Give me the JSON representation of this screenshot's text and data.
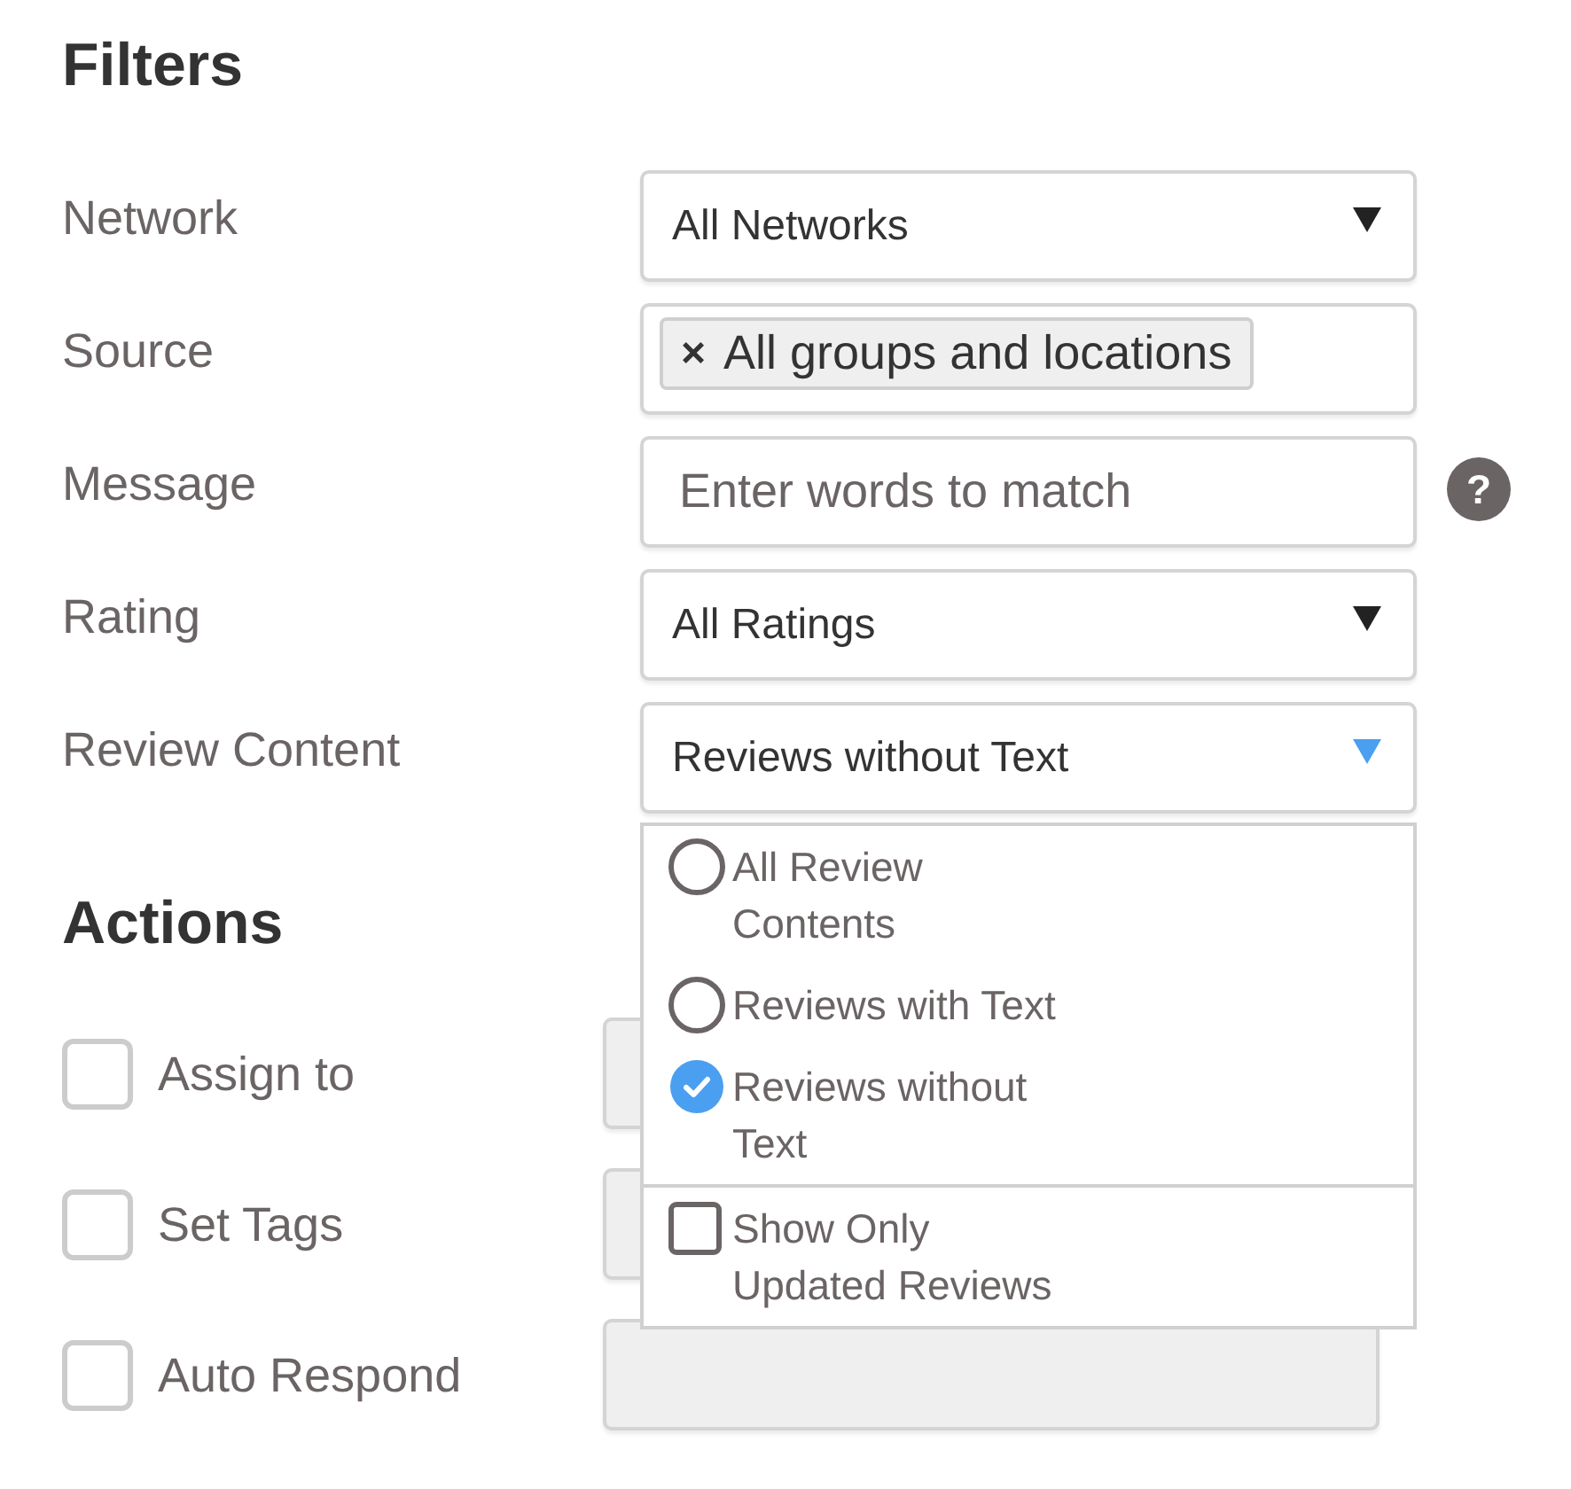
{
  "filters": {
    "title": "Filters",
    "rows": [
      {
        "label": "Network",
        "kind": "select",
        "value": "All Networks",
        "open": false
      },
      {
        "label": "Source",
        "kind": "tags",
        "tags": [
          {
            "remove": "×",
            "label": "All groups and locations"
          }
        ]
      },
      {
        "label": "Message",
        "kind": "text",
        "placeholder": "Enter words to match",
        "help": "?"
      },
      {
        "label": "Rating",
        "kind": "select",
        "value": "All Ratings",
        "open": false
      },
      {
        "label": "Review Content",
        "kind": "select",
        "value": "Reviews without Text",
        "open": true,
        "dropdown": {
          "options": [
            {
              "label": "All Review Contents",
              "selected": false
            },
            {
              "label": "Reviews with Text",
              "selected": false
            },
            {
              "label": "Reviews without Text",
              "selected": true
            }
          ],
          "toggle": {
            "label": "Show Only Updated Reviews",
            "checked": false
          }
        }
      }
    ]
  },
  "actions": {
    "title": "Actions",
    "items": [
      {
        "label": "Assign to",
        "checked": false,
        "disabled": true
      },
      {
        "label": "Set Tags",
        "checked": false,
        "disabled": true
      },
      {
        "label": "Auto Respond",
        "checked": false,
        "disabled": true
      }
    ]
  }
}
